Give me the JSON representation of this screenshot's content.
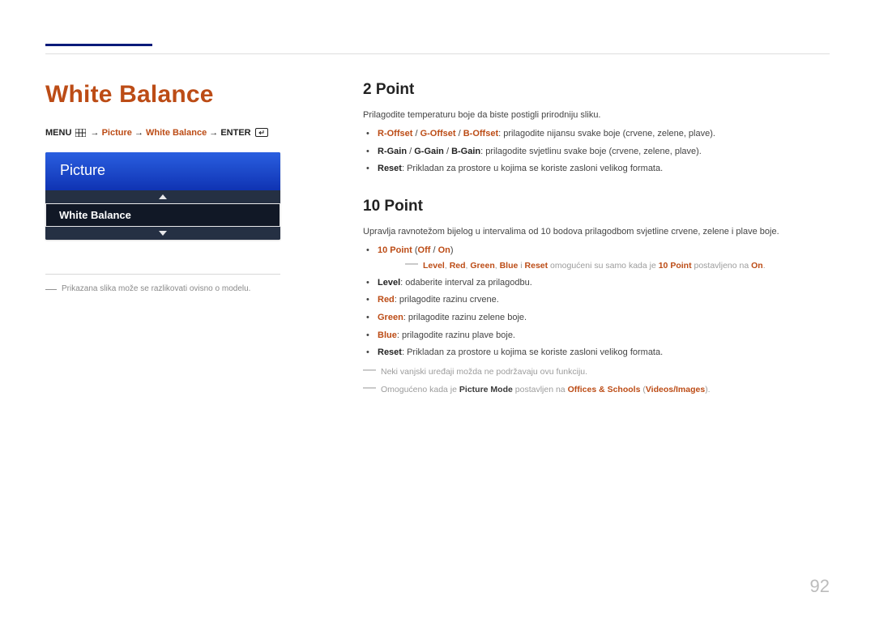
{
  "left": {
    "title": "White Balance",
    "breadcrumb": {
      "menu": "MENU",
      "arrow": "→",
      "picture": "Picture",
      "whiteBalance": "White Balance",
      "enter": "ENTER"
    },
    "osd": {
      "header": "Picture",
      "item": "White Balance"
    },
    "captionDash": "―",
    "caption": "Prikazana slika može se razlikovati ovisno o modelu."
  },
  "right": {
    "h2a": "2 Point",
    "intro2": "Prilagodite temperaturu boje da biste postigli prirodniju sliku.",
    "b2": {
      "offsetLabel": "R-Offset",
      "offsetLabel2": "G-Offset",
      "offsetLabel3": "B-Offset",
      "offsetRest": ": prilagodite nijansu svake boje (crvene, zelene, plave).",
      "gainLabel": "R-Gain",
      "gainLabel2": "G-Gain",
      "gainLabel3": "B-Gain",
      "gainRest": ": prilagodite svjetlinu svake boje (crvene, zelene, plave).",
      "resetLabel": "Reset",
      "resetRest": ": Prikladan za prostore u kojima se koriste zasloni velikog formata."
    },
    "h2b": "10 Point",
    "intro10": "Upravlja ravnotežom bijelog u intervalima od 10 bodova prilagodbom svjetline crvene, zelene i plave boje.",
    "b10": {
      "tenPoint": "10 Point",
      "tenPointOff": "Off",
      "tenPointOn": "On",
      "slash": " / ",
      "paren_open": " (",
      "paren_close": ")",
      "noteLevel": "Level",
      "noteRed": "Red",
      "noteGreen": "Green",
      "noteBlue": "Blue",
      "noteAnd": " i ",
      "noteReset": "Reset",
      "noteMid": " omogućeni su samo kada je ",
      "note10p": "10 Point",
      "noteSet": " postavljeno na ",
      "noteOn": "On",
      "noteEnd": ".",
      "levelLabel": "Level",
      "levelRest": ": odaberite interval za prilagodbu.",
      "redLabel": "Red",
      "redRest": ": prilagodite razinu crvene.",
      "greenLabel": "Green",
      "greenRest": ": prilagodite razinu zelene boje.",
      "blueLabel": "Blue",
      "blueRest": ": prilagodite razinu plave boje.",
      "resetLabel": "Reset",
      "resetRest": ": Prikladan za prostore u kojima se koriste zasloni velikog formata."
    },
    "footnote1": "Neki vanjski uređaji možda ne podržavaju ovu funkciju.",
    "footnote2a": "Omogućeno kada je ",
    "footnote2b": "Picture Mode",
    "footnote2c": " postavljen na ",
    "footnote2d": "Offices & Schools",
    "footnote2e": " (",
    "footnote2f": "Videos/Images",
    "footnote2g": ")."
  },
  "pageNumber": "92"
}
